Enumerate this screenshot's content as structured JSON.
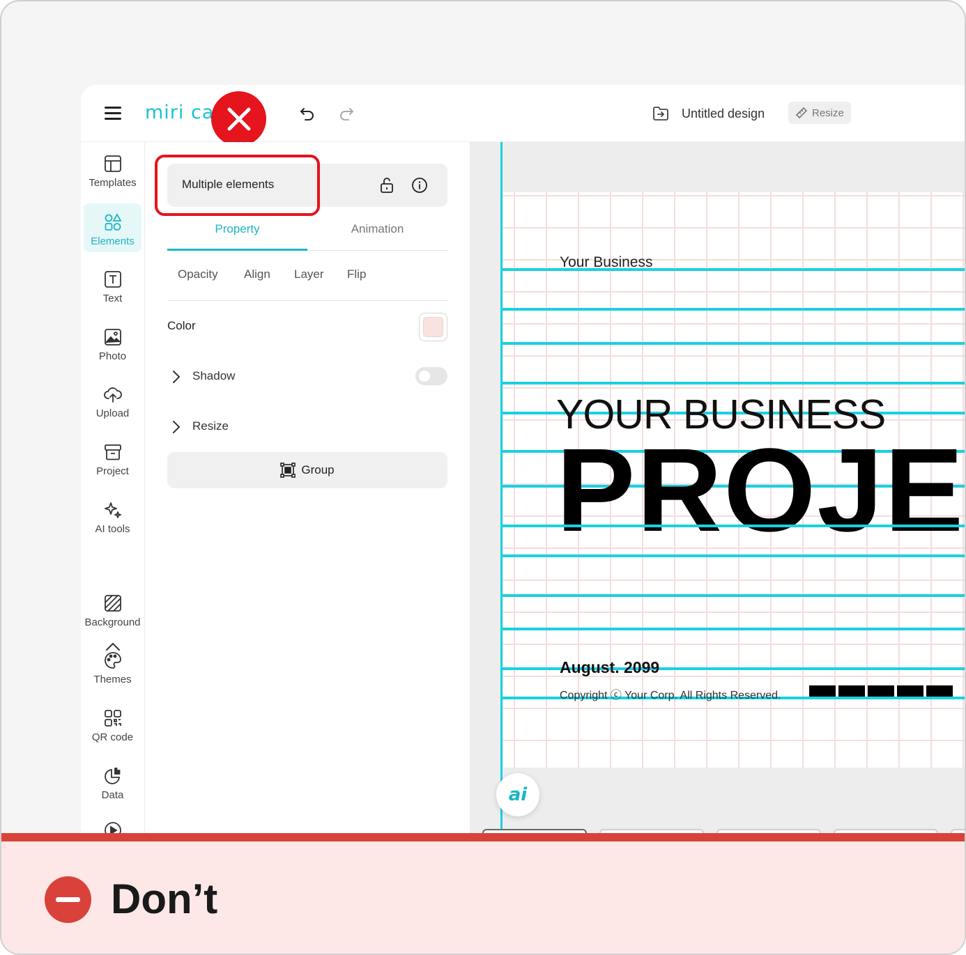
{
  "header": {
    "logo_text": "miri ca",
    "document_title": "Untitled design",
    "resize_label": "Resize"
  },
  "sidebar": {
    "items": [
      {
        "label": "Templates",
        "icon": "layout-icon"
      },
      {
        "label": "Elements",
        "icon": "shapes-icon",
        "active": true
      },
      {
        "label": "Text",
        "icon": "text-icon"
      },
      {
        "label": "Photo",
        "icon": "image-icon"
      },
      {
        "label": "Upload",
        "icon": "cloud-upload-icon"
      },
      {
        "label": "Project",
        "icon": "archive-icon"
      },
      {
        "label": "AI tools",
        "icon": "sparkle-icon"
      },
      {
        "label": "Background",
        "icon": "hatch-icon"
      },
      {
        "label": "Themes",
        "icon": "palette-icon"
      },
      {
        "label": "QR code",
        "icon": "qr-icon"
      },
      {
        "label": "Data",
        "icon": "pie-chart-icon"
      }
    ]
  },
  "panel": {
    "selection_label": "Multiple elements",
    "tabs": [
      "Property",
      "Animation"
    ],
    "active_tab": "Property",
    "subtabs": [
      "Opacity",
      "Align",
      "Layer",
      "Flip"
    ],
    "color_label": "Color",
    "color_value": "#f8e3e1",
    "shadow_label": "Shadow",
    "shadow_enabled": false,
    "resize_label": "Resize",
    "group_label": "Group"
  },
  "canvas": {
    "text_your_business_small": "Your Business",
    "text_your_business_large": "YOUR BUSINESS",
    "text_project": "PROJECT",
    "text_date": "August. 2099",
    "text_copyright": "Copyright ⓒ Your Corp. All Rights Reserved.",
    "ai_button_label": "ai"
  },
  "footer": {
    "verdict": "Don’t"
  },
  "colors": {
    "accent": "#19b7c3",
    "guide": "#19d1e0",
    "error": "#e5141d",
    "dont_bg": "#fde8e7",
    "dont_bar": "#d9423a"
  }
}
